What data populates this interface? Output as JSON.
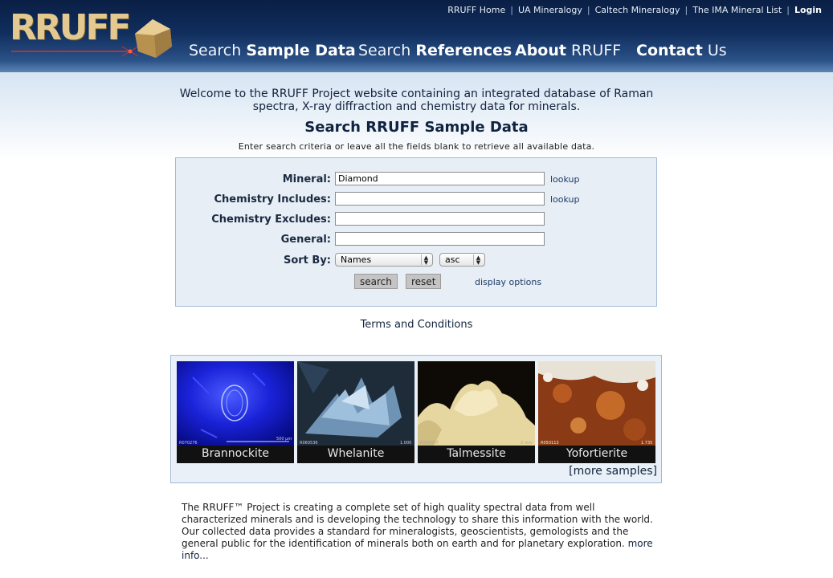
{
  "logo": {
    "text": "RRUFF"
  },
  "top_links": [
    {
      "label": "RRUFF Home"
    },
    {
      "label": "UA Mineralogy"
    },
    {
      "label": "Caltech Mineralogy"
    },
    {
      "label": "The IMA Mineral List"
    },
    {
      "label": "Login"
    }
  ],
  "nav": {
    "search_sample": {
      "light": "Search ",
      "bold": "Sample Data"
    },
    "search_refs": {
      "light": "Search ",
      "bold": "References"
    },
    "about": {
      "bold": "About",
      "light": " RRUFF"
    },
    "contact": {
      "bold": "Contact",
      "light": " Us"
    }
  },
  "welcome": "Welcome to the RRUFF Project website containing an integrated database of Raman spectra, X-ray diffraction and chemistry data for minerals.",
  "search": {
    "title": "Search RRUFF Sample Data",
    "hint": "Enter search criteria or leave all the fields blank to retrieve all available data.",
    "mineral_label": "Mineral:",
    "mineral_value": "Diamond",
    "chem_inc_label": "Chemistry Includes:",
    "chem_inc_value": "",
    "chem_exc_label": "Chemistry Excludes:",
    "chem_exc_value": "",
    "general_label": "General:",
    "general_value": "",
    "lookup_label": "lookup",
    "sortby_label": "Sort By:",
    "sort_field": "Names",
    "sort_order": "asc",
    "search_button": "search",
    "reset_button": "reset",
    "display_options": "display options"
  },
  "terms": "Terms and Conditions",
  "samples": [
    {
      "name": "Brannockite",
      "id": "R070276",
      "scale": "500 μm"
    },
    {
      "name": "Whelanite",
      "id": "R060536",
      "scale": "1.000"
    },
    {
      "name": "Talmessite",
      "id": "R060007",
      "scale": "2 mm"
    },
    {
      "name": "Yofortierite",
      "id": "R050113",
      "scale": "1.735"
    }
  ],
  "more_samples": "[more samples]",
  "about": {
    "text": "The RRUFF™ Project is creating a complete set of high quality spectral data from well characterized minerals and is developing the technology to share this information with the world. Our collected data provides a standard for mineralogists, geoscientists, gemologists and the general public for the identification of minerals both on earth and for planetary exploration. ",
    "more": "more info..."
  },
  "colors": {
    "header_dark": "#0a1f45",
    "form_bg": "#e7eef6",
    "form_border": "#9fbcd8",
    "logo_gold": "#e3c98f"
  }
}
